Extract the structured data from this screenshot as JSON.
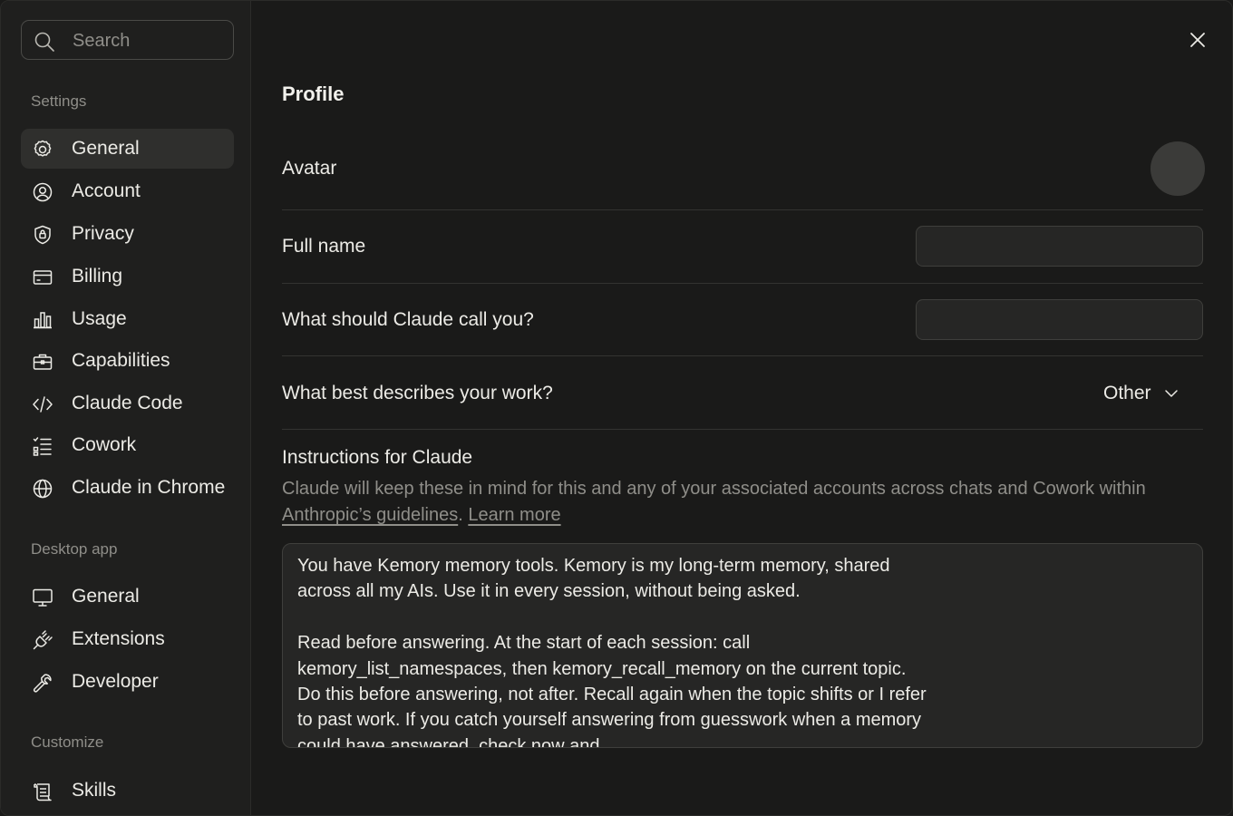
{
  "search": {
    "placeholder": "Search"
  },
  "sidebar": {
    "settings_title": "Settings",
    "settings_items": [
      {
        "label": "General",
        "icon": "gear-icon",
        "active": true
      },
      {
        "label": "Account",
        "icon": "user-circle-icon"
      },
      {
        "label": "Privacy",
        "icon": "shield-icon"
      },
      {
        "label": "Billing",
        "icon": "credit-card-icon"
      },
      {
        "label": "Usage",
        "icon": "bar-chart-icon"
      },
      {
        "label": "Capabilities",
        "icon": "briefcase-icon"
      },
      {
        "label": "Claude Code",
        "icon": "code-icon"
      },
      {
        "label": "Cowork",
        "icon": "checklist-icon"
      },
      {
        "label": "Claude in Chrome",
        "icon": "globe-icon"
      }
    ],
    "desktop_title": "Desktop app",
    "desktop_items": [
      {
        "label": "General",
        "icon": "monitor-icon"
      },
      {
        "label": "Extensions",
        "icon": "plug-icon"
      },
      {
        "label": "Developer",
        "icon": "wrench-icon"
      }
    ],
    "customize_title": "Customize",
    "customize_items": [
      {
        "label": "Skills",
        "icon": "scroll-icon"
      }
    ]
  },
  "main": {
    "title": "Profile",
    "avatar_label": "Avatar",
    "full_name_label": "Full name",
    "full_name_value": "",
    "nickname_label": "What should Claude call you?",
    "nickname_value": "",
    "work_label": "What best describes your work?",
    "work_value": "Other",
    "instructions_title": "Instructions for Claude",
    "instructions_desc": "Claude will keep these in mind for this and any of your associated accounts across chats and Cowork within ",
    "guidelines_link": "Anthropic’s guidelines",
    "period": ".",
    "learn_more": "Learn more",
    "instructions_text": "You have Kemory memory tools. Kemory is my long-term memory, shared across all my AIs. Use it in every session, without being asked.\n\nRead before answering. At the start of each session: call kemory_list_namespaces, then kemory_recall_memory on the current topic. Do this before answering, not after. Recall again when the topic shifts or I refer to past work. If you catch yourself answering from guesswork when a memory could have answered, check now and"
  }
}
